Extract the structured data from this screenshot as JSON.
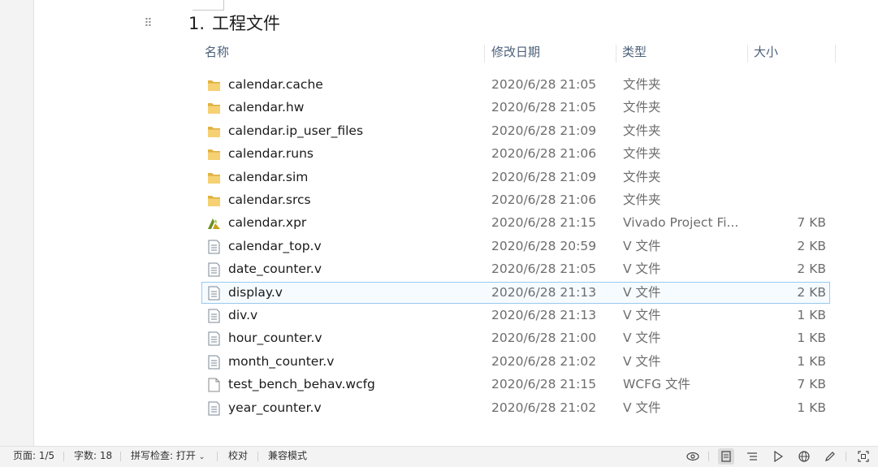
{
  "document": {
    "heading_number": "1.",
    "heading_text": "工程文件"
  },
  "explorer": {
    "columns": {
      "name": "名称",
      "date": "修改日期",
      "type": "类型",
      "size": "大小"
    },
    "files": [
      {
        "name": "calendar.cache",
        "date": "2020/6/28 21:05",
        "type": "文件夹",
        "size": "",
        "icon": "folder-icon"
      },
      {
        "name": "calendar.hw",
        "date": "2020/6/28 21:05",
        "type": "文件夹",
        "size": "",
        "icon": "folder-icon"
      },
      {
        "name": "calendar.ip_user_files",
        "date": "2020/6/28 21:09",
        "type": "文件夹",
        "size": "",
        "icon": "folder-icon"
      },
      {
        "name": "calendar.runs",
        "date": "2020/6/28 21:06",
        "type": "文件夹",
        "size": "",
        "icon": "folder-icon"
      },
      {
        "name": "calendar.sim",
        "date": "2020/6/28 21:09",
        "type": "文件夹",
        "size": "",
        "icon": "folder-icon"
      },
      {
        "name": "calendar.srcs",
        "date": "2020/6/28 21:06",
        "type": "文件夹",
        "size": "",
        "icon": "folder-icon"
      },
      {
        "name": "calendar.xpr",
        "date": "2020/6/28 21:15",
        "type": "Vivado Project Fi...",
        "size": "7 KB",
        "icon": "vivado-project-icon"
      },
      {
        "name": "calendar_top.v",
        "date": "2020/6/28 20:59",
        "type": "V 文件",
        "size": "2 KB",
        "icon": "text-file-icon"
      },
      {
        "name": "date_counter.v",
        "date": "2020/6/28 21:05",
        "type": "V 文件",
        "size": "2 KB",
        "icon": "text-file-icon"
      },
      {
        "name": "display.v",
        "date": "2020/6/28 21:13",
        "type": "V 文件",
        "size": "2 KB",
        "icon": "text-file-icon",
        "selected": true
      },
      {
        "name": "div.v",
        "date": "2020/6/28 21:13",
        "type": "V 文件",
        "size": "1 KB",
        "icon": "text-file-icon"
      },
      {
        "name": "hour_counter.v",
        "date": "2020/6/28 21:00",
        "type": "V 文件",
        "size": "1 KB",
        "icon": "text-file-icon"
      },
      {
        "name": "month_counter.v",
        "date": "2020/6/28 21:02",
        "type": "V 文件",
        "size": "1 KB",
        "icon": "text-file-icon"
      },
      {
        "name": "test_bench_behav.wcfg",
        "date": "2020/6/28 21:15",
        "type": "WCFG 文件",
        "size": "7 KB",
        "icon": "blank-file-icon"
      },
      {
        "name": "year_counter.v",
        "date": "2020/6/28 21:02",
        "type": "V 文件",
        "size": "1 KB",
        "icon": "text-file-icon"
      }
    ]
  },
  "status_bar": {
    "page": "页面: 1/5",
    "word_count": "字数: 18",
    "spell_check": "拼写检查: 打开",
    "proofread": "校对",
    "compat_mode": "兼容模式",
    "view_icons": [
      "eye-icon",
      "page-view-icon",
      "outline-view-icon",
      "play-icon",
      "web-view-icon",
      "pen-icon",
      "fit-screen-icon"
    ]
  }
}
